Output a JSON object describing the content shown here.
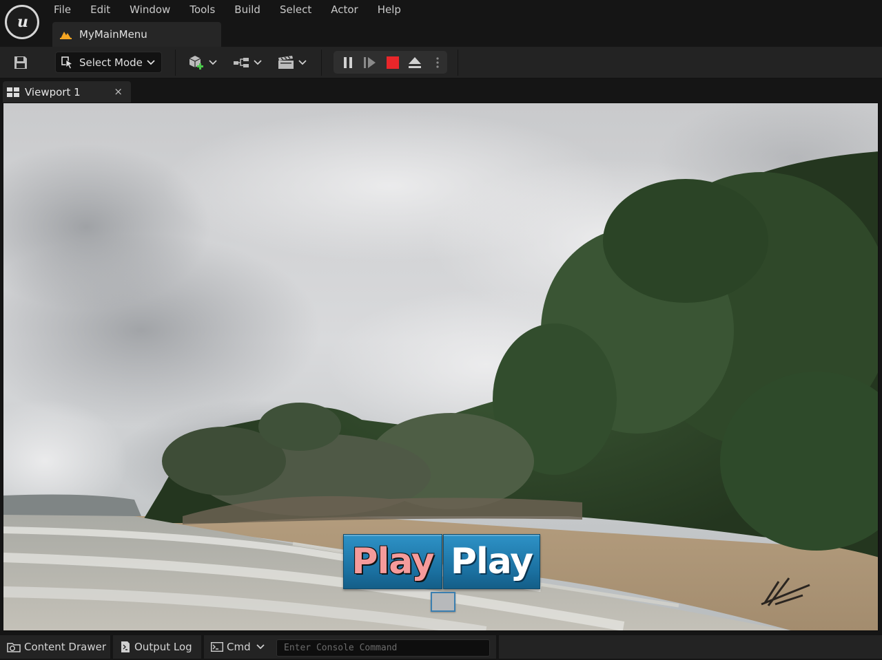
{
  "menu": [
    "File",
    "Edit",
    "Window",
    "Tools",
    "Build",
    "Select",
    "Actor",
    "Help"
  ],
  "level_tab": {
    "name": "MyMainMenu"
  },
  "toolbar": {
    "select_mode_label": "Select Mode"
  },
  "viewport_tab": {
    "label": "Viewport 1",
    "close_glyph": "×"
  },
  "viewport": {
    "play_button_1": "Play",
    "play_button_2": "Play"
  },
  "statusbar": {
    "content_drawer": "Content Drawer",
    "output_log": "Output Log",
    "cmd": "Cmd",
    "console_placeholder": "Enter Console Command"
  },
  "colors": {
    "accent_orange": "#f5a623",
    "stop_red": "#e8262a",
    "play_blue": "#1a7bb0",
    "play_text_pink": "#f59b9b"
  },
  "icons": [
    "unreal-logo-icon",
    "level-icon",
    "save-icon",
    "cursor-icon",
    "add-actor-icon",
    "blueprint-icon",
    "cinematics-icon",
    "pause-icon",
    "step-icon",
    "stop-icon",
    "eject-icon",
    "more-icon",
    "viewport-layout-icon",
    "content-drawer-icon",
    "output-log-icon",
    "terminal-icon",
    "chevron-down-icon"
  ]
}
